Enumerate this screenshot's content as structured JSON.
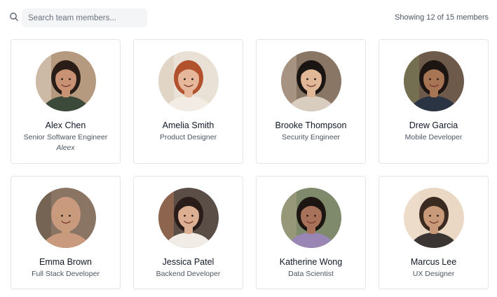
{
  "search": {
    "placeholder": "Search team members...",
    "value": ""
  },
  "result_count": "Showing 12 of 15 members",
  "members": [
    {
      "name": "Alex Chen",
      "role": "Senior Software Engineer",
      "nickname": "Aleex",
      "avatar": {
        "bg": "#b59a80",
        "skin": "#c99274",
        "hair": "#2a1d17",
        "shirt": "#3c4a3a",
        "accent": "#e9e2d6"
      }
    },
    {
      "name": "Amelia Smith",
      "role": "Product Designer",
      "nickname": "",
      "avatar": {
        "bg": "#e9e1d6",
        "skin": "#e7b79b",
        "hair": "#b2522d",
        "shirt": "#f2ece4",
        "accent": "#d8c8b4"
      }
    },
    {
      "name": "Brooke Thompson",
      "role": "Security Engineer",
      "nickname": "",
      "avatar": {
        "bg": "#8a7664",
        "skin": "#e0b898",
        "hair": "#1a1412",
        "shirt": "#d8cdbf",
        "accent": "#c7b8a4"
      }
    },
    {
      "name": "Drew Garcia",
      "role": "Mobile Developer",
      "nickname": "",
      "avatar": {
        "bg": "#6e5a4a",
        "skin": "#a77454",
        "hair": "#1c1512",
        "shirt": "#2b3442",
        "accent": "#7c8a5a"
      }
    },
    {
      "name": "Emma Brown",
      "role": "Full Stack Developer",
      "nickname": "",
      "avatar": {
        "bg": "#8a7565",
        "skin": "#c99b7d",
        "hair": "#c99a7e",
        "shirt": "#c99a7e",
        "accent": "#5c4d40"
      }
    },
    {
      "name": "Jessica Patel",
      "role": "Backend Developer",
      "nickname": "",
      "avatar": {
        "bg": "#5b4e46",
        "skin": "#dcae92",
        "hair": "#2a1d19",
        "shirt": "#f1ede6",
        "accent": "#c9835a"
      }
    },
    {
      "name": "Katherine Wong",
      "role": "Data Scientist",
      "nickname": "",
      "avatar": {
        "bg": "#7e8a6b",
        "skin": "#a8725a",
        "hair": "#1d1512",
        "shirt": "#9a86b4",
        "accent": "#b6a68e"
      }
    },
    {
      "name": "Marcus Lee",
      "role": "UX Designer",
      "nickname": "",
      "avatar": {
        "bg": "#ead8c4",
        "skin": "#c99a7a",
        "hair": "#3a2a20",
        "shirt": "#3a3532",
        "accent": "#f1e3d2"
      }
    }
  ]
}
